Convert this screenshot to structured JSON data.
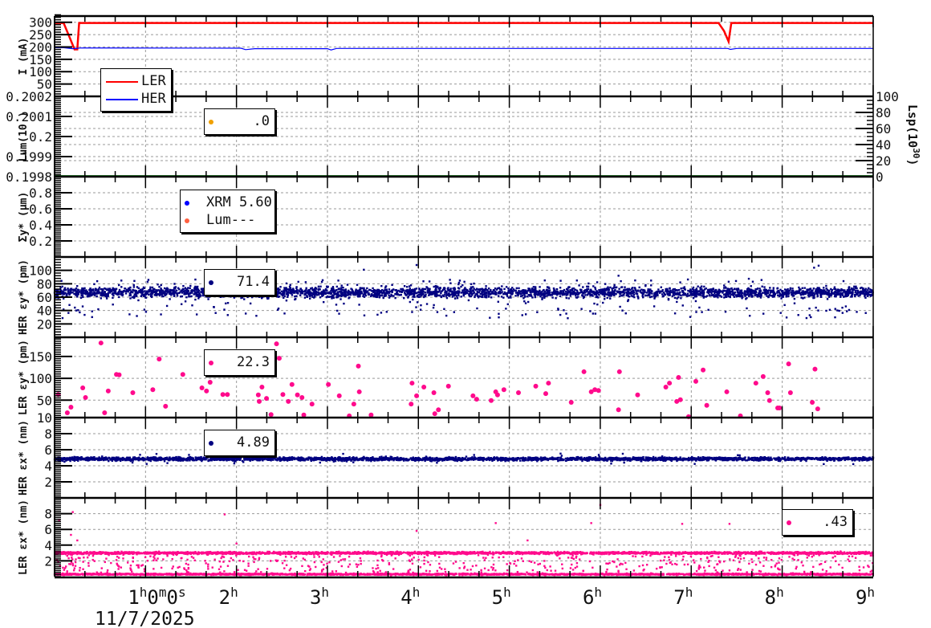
{
  "chart_data": {
    "type": "scatter",
    "x_axis": {
      "xlim": [
        0,
        9
      ],
      "unit": "hours",
      "tick_labels": [
        {
          "h": 1,
          "base": "1",
          "sup1": "h",
          "mid": "0",
          "sup2": "m",
          "mid2": "0",
          "sup3": "s"
        },
        {
          "h": 2,
          "base": "2",
          "sup1": "h"
        },
        {
          "h": 3,
          "base": "3",
          "sup1": "h"
        },
        {
          "h": 4,
          "base": "4",
          "sup1": "h"
        },
        {
          "h": 5,
          "base": "5",
          "sup1": "h"
        },
        {
          "h": 6,
          "base": "6",
          "sup1": "h"
        },
        {
          "h": 7,
          "base": "7",
          "sup1": "h"
        },
        {
          "h": 8,
          "base": "8",
          "sup1": "h"
        },
        {
          "h": 9,
          "base": "9",
          "sup1": "h"
        }
      ],
      "date": "11/7/2025",
      "minor_step_h": 0.3333
    },
    "panels": [
      {
        "id": "current",
        "ylabel": "I (mA)",
        "ylim": [
          0,
          325
        ],
        "yticks": [
          50,
          100,
          150,
          200,
          250,
          300
        ],
        "minor_step": 10,
        "series": [
          {
            "name": "LER",
            "kind": "line",
            "color": "#ff0000",
            "points": [
              [
                0,
                297
              ],
              [
                0.1,
                297
              ],
              [
                0.22,
                190
              ],
              [
                0.25,
                190
              ],
              [
                0.27,
                297
              ],
              [
                7.3,
                297
              ],
              [
                7.36,
                265
              ],
              [
                7.41,
                222
              ],
              [
                7.44,
                297
              ],
              [
                9,
                297
              ]
            ]
          },
          {
            "name": "HER",
            "kind": "line",
            "color": "#0000ff",
            "points": [
              [
                0,
                197
              ],
              [
                0.1,
                197
              ],
              [
                0.2,
                193
              ],
              [
                0.3,
                196
              ],
              [
                2.05,
                195
              ],
              [
                2.1,
                189
              ],
              [
                2.2,
                193
              ],
              [
                3.0,
                193
              ],
              [
                3.04,
                188
              ],
              [
                3.1,
                194
              ],
              [
                7.4,
                194
              ],
              [
                7.43,
                190
              ],
              [
                7.5,
                194
              ],
              [
                9,
                194
              ]
            ]
          }
        ],
        "legend": {
          "entries": [
            "LER",
            "HER"
          ]
        }
      },
      {
        "id": "luminosity",
        "ylabel": "Lum(10   )",
        "ylabel_right": "Lsp(10",
        "ylabel_right_sup": "30",
        "ylabel_right_close": ")",
        "ylim": [
          0.1998,
          0.2002
        ],
        "yticks": [
          0.1998,
          0.1999,
          0.2,
          0.2001,
          0.2002
        ],
        "ytick_labels": [
          "0.1998",
          "0.1999",
          "0.2",
          "0.2001",
          "0.2002"
        ],
        "ylim_right": [
          0,
          100
        ],
        "yticks_right": [
          0,
          20,
          40,
          60,
          80,
          100
        ],
        "minor_step": 1e-05,
        "series": [
          {
            "name": "Lsp",
            "kind": "hline",
            "axis": "right",
            "value": 0,
            "color": "#2e7d32"
          }
        ],
        "legend": {
          "entries": [
            ".0"
          ],
          "colors": [
            "#f0a000"
          ]
        }
      },
      {
        "id": "sigma-y",
        "ylabel": "Σy* (μm)",
        "ylim": [
          0,
          1
        ],
        "yticks": [
          0.2,
          0.4,
          0.6,
          0.8
        ],
        "minor_step": 0.025,
        "series": [],
        "legend": {
          "entries": [
            "XRM 5.60",
            "Lum---"
          ],
          "colors": [
            "#0000ff",
            "#ff6040"
          ]
        }
      },
      {
        "id": "her-emit-y",
        "ylabel": "HER εy* (pm)",
        "ylim": [
          0,
          120
        ],
        "yticks": [
          20,
          40,
          60,
          80,
          100
        ],
        "minor_step": 4,
        "series": [
          {
            "name": "HER εy*",
            "kind": "band",
            "color": "#000080",
            "center": 67,
            "spread": 6.5,
            "count": 3200,
            "outlier_count": 260,
            "outlier_range": [
              28,
              88
            ],
            "extremes": [
              [
                3.4,
                101
              ],
              [
                3.98,
                108
              ],
              [
                8.35,
                104
              ],
              [
                8.4,
                107
              ],
              [
                6.2,
                92
              ]
            ]
          }
        ],
        "legend": {
          "entries": [
            "71.4"
          ],
          "colors": [
            "#000080"
          ]
        }
      },
      {
        "id": "ler-emit-y",
        "ylabel": "LER εy* (pm)",
        "ylim": [
          10,
          194
        ],
        "yticks": [
          10,
          50,
          100,
          150
        ],
        "minor_step": 5,
        "series": [
          {
            "name": "LER εy*",
            "kind": "points",
            "color": "#ff0a8c",
            "points": [
              [
                0.04,
                63
              ],
              [
                0.14,
                21
              ],
              [
                0.18,
                34
              ],
              [
                0.31,
                78
              ],
              [
                0.34,
                56
              ],
              [
                0.51,
                181
              ],
              [
                0.55,
                21
              ],
              [
                0.59,
                71
              ],
              [
                0.68,
                109
              ],
              [
                0.71,
                108
              ],
              [
                0.86,
                67
              ],
              [
                1.08,
                74
              ],
              [
                1.15,
                144
              ],
              [
                1.22,
                36
              ],
              [
                1.41,
                109
              ],
              [
                1.62,
                78
              ],
              [
                1.67,
                71
              ],
              [
                1.71,
                91
              ],
              [
                1.71,
                139
              ],
              [
                1.85,
                63
              ],
              [
                1.9,
                63
              ],
              [
                2.24,
                62
              ],
              [
                2.25,
                47
              ],
              [
                2.28,
                80
              ],
              [
                2.33,
                54
              ],
              [
                2.38,
                17
              ],
              [
                2.44,
                179
              ],
              [
                2.47,
                146
              ],
              [
                2.51,
                63
              ],
              [
                2.57,
                47
              ],
              [
                2.61,
                86
              ],
              [
                2.67,
                62
              ],
              [
                2.72,
                56
              ],
              [
                2.74,
                16
              ],
              [
                2.83,
                41
              ],
              [
                3.01,
                86
              ],
              [
                3.13,
                60
              ],
              [
                3.24,
                14
              ],
              [
                3.29,
                41
              ],
              [
                3.34,
                128
              ],
              [
                3.35,
                69
              ],
              [
                3.48,
                16
              ],
              [
                3.92,
                41
              ],
              [
                3.93,
                89
              ],
              [
                3.98,
                60
              ],
              [
                4.06,
                80
              ],
              [
                4.17,
                67
              ],
              [
                4.18,
                19
              ],
              [
                4.22,
                28
              ],
              [
                4.33,
                82
              ],
              [
                4.6,
                60
              ],
              [
                4.64,
                52
              ],
              [
                4.8,
                49
              ],
              [
                4.85,
                69
              ],
              [
                4.87,
                62
              ],
              [
                4.94,
                74
              ],
              [
                5.1,
                67
              ],
              [
                5.29,
                82
              ],
              [
                5.4,
                65
              ],
              [
                5.43,
                89
              ],
              [
                5.68,
                45
              ],
              [
                5.82,
                115
              ],
              [
                5.9,
                69
              ],
              [
                5.94,
                74
              ],
              [
                5.98,
                72
              ],
              [
                6.2,
                28
              ],
              [
                6.21,
                115
              ],
              [
                6.41,
                62
              ],
              [
                6.72,
                80
              ],
              [
                6.76,
                89
              ],
              [
                6.84,
                47
              ],
              [
                6.86,
                102
              ],
              [
                6.88,
                51
              ],
              [
                6.97,
                12
              ],
              [
                7.05,
                93
              ],
              [
                7.13,
                119
              ],
              [
                7.17,
                38
              ],
              [
                7.39,
                69
              ],
              [
                7.54,
                14
              ],
              [
                7.71,
                89
              ],
              [
                7.79,
                104
              ],
              [
                7.84,
                67
              ],
              [
                7.86,
                49
              ],
              [
                7.95,
                32
              ],
              [
                7.97,
                32
              ],
              [
                8.07,
                133
              ],
              [
                8.09,
                67
              ],
              [
                8.33,
                45
              ],
              [
                8.36,
                121
              ],
              [
                8.39,
                30
              ]
            ]
          }
        ],
        "legend": {
          "entries": [
            "22.3"
          ],
          "colors": [
            "#ff0a8c"
          ]
        }
      },
      {
        "id": "her-emit-x",
        "ylabel": "HER εx* (nm)",
        "ylim": [
          0,
          10
        ],
        "yticks": [
          2,
          4,
          6,
          8
        ],
        "minor_step": 0.25,
        "series": [
          {
            "name": "HER εx*",
            "kind": "band",
            "color": "#000080",
            "center": 4.85,
            "spread": 0.18,
            "count": 3000,
            "outlier_count": 60,
            "outlier_range": [
              4.2,
              5.6
            ],
            "extremes": []
          }
        ],
        "legend": {
          "entries": [
            "4.89"
          ],
          "colors": [
            "#000080"
          ]
        }
      },
      {
        "id": "ler-emit-x",
        "ylabel": "LER εx* (nm)",
        "ylim": [
          0,
          10
        ],
        "yticks": [
          2,
          4,
          6,
          8
        ],
        "minor_step": 0.25,
        "series": [
          {
            "name": "LER εx* upper",
            "kind": "band",
            "color": "#ff0a8c",
            "center": 3.0,
            "spread": 0.12,
            "count": 2600,
            "outlier_count": 500,
            "outlier_range": [
              0.5,
              2.8
            ],
            "extremes": [
              [
                0.2,
                8.2
              ],
              [
                0.05,
                7.2
              ],
              [
                0.18,
                5.3
              ],
              [
                0.25,
                4.6
              ],
              [
                1.87,
                7.9
              ],
              [
                2.0,
                4.2
              ],
              [
                6.0,
                9.1
              ],
              [
                5.9,
                6.8
              ],
              [
                4.85,
                6.8
              ],
              [
                6.9,
                6.7
              ],
              [
                7.42,
                6.7
              ],
              [
                8.3,
                8.3
              ],
              [
                8.5,
                6.6
              ],
              [
                3.98,
                5.8
              ],
              [
                5.2,
                4.6
              ]
            ]
          },
          {
            "name": "LER εx* lower",
            "kind": "band",
            "color": "#ff0a8c",
            "center": 0.3,
            "spread": 0.08,
            "count": 2600,
            "outlier_count": 0,
            "outlier_range": [
              0,
              0
            ],
            "extremes": []
          }
        ],
        "legend": {
          "entries": [
            ".43"
          ],
          "colors": [
            "#ff0a8c"
          ]
        }
      }
    ]
  }
}
